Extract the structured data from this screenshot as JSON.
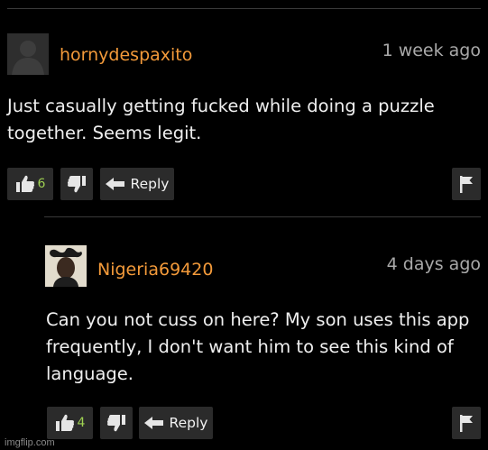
{
  "comments": [
    {
      "username": "hornydespaxito",
      "time": "1 week ago",
      "text_lines": [
        "Just casually getting fucked while doing a puzzle",
        "together. Seems legit."
      ],
      "likes": "6",
      "reply_label": "Reply"
    },
    {
      "username": "Nigeria69420",
      "time": "4 days ago",
      "text_lines": [
        "Can you not cuss on here? My son uses this app",
        "frequently, I don't want him to see this kind of",
        "language."
      ],
      "likes": "4",
      "reply_label": "Reply"
    }
  ],
  "watermark": "imgflip.com",
  "colors": {
    "background": "#000000",
    "username": "#f39a3a",
    "like_count": "#9fd152",
    "button_bg": "#2b2b2b"
  }
}
